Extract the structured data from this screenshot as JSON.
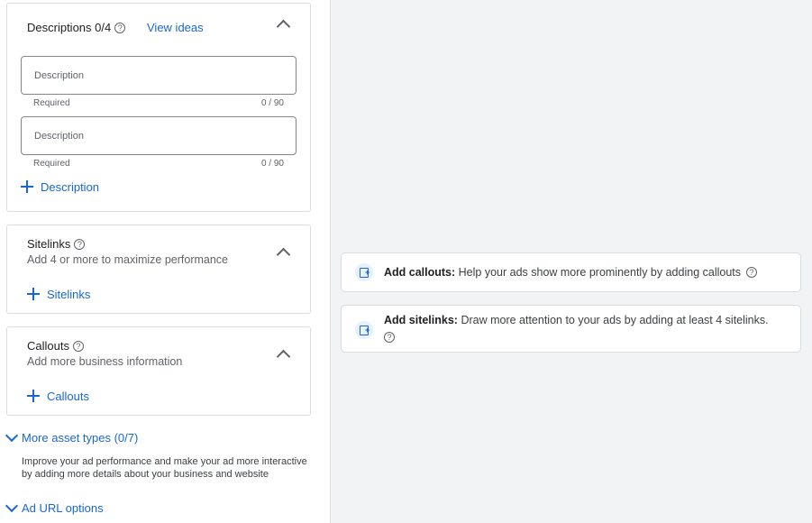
{
  "descriptions": {
    "title": "Descriptions 0/4",
    "help": "?",
    "view_ideas": "View ideas",
    "fields": [
      {
        "placeholder": "Description",
        "hint": "Required",
        "counter": "0 / 90"
      },
      {
        "placeholder": "Description",
        "hint": "Required",
        "counter": "0 / 90"
      }
    ],
    "add_label": "Description"
  },
  "sitelinks": {
    "title": "Sitelinks",
    "help": "?",
    "subtitle": "Add 4 or more to maximize performance",
    "add_label": "Sitelinks"
  },
  "callouts": {
    "title": "Callouts",
    "help": "?",
    "subtitle": "Add more business information",
    "add_label": "Callouts"
  },
  "more_assets": {
    "label": "More asset types (0/7)",
    "description": "Improve your ad performance and make your ad more interactive by adding more details about your business and website"
  },
  "ad_url": {
    "label": "Ad URL options"
  },
  "suggestions": [
    {
      "title": "Add callouts:",
      "text": " Help your ads show more prominently by adding callouts",
      "icon": "add-asset-icon"
    },
    {
      "title": "Add sitelinks:",
      "text": " Draw more attention to your ads by adding at least 4 sitelinks.",
      "icon": "add-asset-icon"
    }
  ],
  "colors": {
    "accent": "#1967d2",
    "panel_bg": "#f1f3f4",
    "border": "#dadce0"
  }
}
